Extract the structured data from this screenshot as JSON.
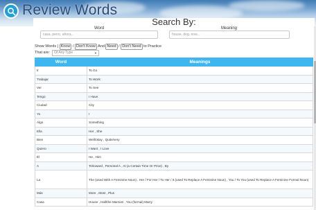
{
  "app": {
    "title": "Review Words"
  },
  "search": {
    "heading": "Search By:",
    "word_label": "Word",
    "word_placeholder": "casa, perro, ahora...",
    "meaning_label": "Meaning",
    "meaning_placeholder": "house, dog, now..."
  },
  "filters": {
    "show_words": "Show Words",
    "sep": "|",
    "know": "Know",
    "slash": "/",
    "dont_know": "Don't Know",
    "and": "And",
    "need": "Need",
    "dont_need": "Don't Need",
    "to_practice": "to Practice",
    "that_are": "That are:",
    "type_value": "Of Any Type"
  },
  "table": {
    "headers": [
      "Word",
      "Meanings"
    ],
    "rows": [
      {
        "word": "Ir",
        "meaning": "To Go"
      },
      {
        "word": "Trabajar",
        "meaning": "To Work"
      },
      {
        "word": "Ver",
        "meaning": "To See"
      },
      {
        "word": "Tengo",
        "meaning": "I Have"
      },
      {
        "word": "Ciudad",
        "meaning": "City"
      },
      {
        "word": "Yo",
        "meaning": "I"
      },
      {
        "word": "Algo",
        "meaning": "Something"
      },
      {
        "word": "Ella",
        "meaning": "Her , She"
      },
      {
        "word": "Bien",
        "meaning": "Well/okay , Quite/very"
      },
      {
        "word": "Quiero",
        "meaning": "I Want , I Love"
      },
      {
        "word": "Él",
        "meaning": "He , Him"
      },
      {
        "word": "A",
        "meaning": "To/toward , Personal A , At (a Certain Time Or Price) , By"
      },
      {
        "word": "La",
        "meaning": "The (used With A Feminine Noun) , Her / For Her / To Her / It (used To Replace A Feminine Noun) , You / To You (used To Replace A Feminine Formal Noun)"
      },
      {
        "word": "Más",
        "meaning": "More , Most , Plus"
      },
      {
        "word": "Casa",
        "meaning": "House , Hall/the Marnies , You (formal) Marry"
      }
    ]
  }
}
